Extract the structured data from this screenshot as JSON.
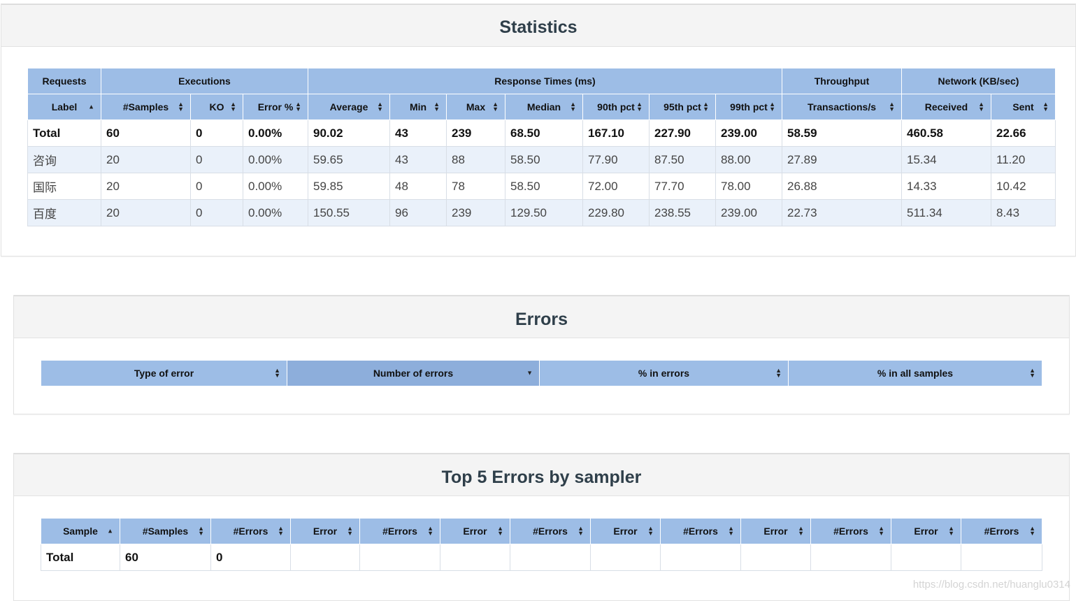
{
  "statistics": {
    "title": "Statistics",
    "groups": [
      "Requests",
      "Executions",
      "Response Times (ms)",
      "Throughput",
      "Network (KB/sec)"
    ],
    "columns": [
      "Label",
      "#Samples",
      "KO",
      "Error %",
      "Average",
      "Min",
      "Max",
      "Median",
      "90th pct",
      "95th pct",
      "99th pct",
      "Transactions/s",
      "Received",
      "Sent"
    ],
    "total": [
      "Total",
      "60",
      "0",
      "0.00%",
      "90.02",
      "43",
      "239",
      "68.50",
      "167.10",
      "227.90",
      "239.00",
      "58.59",
      "460.58",
      "22.66"
    ],
    "rows": [
      [
        "咨询",
        "20",
        "0",
        "0.00%",
        "59.65",
        "43",
        "88",
        "58.50",
        "77.90",
        "87.50",
        "88.00",
        "27.89",
        "15.34",
        "11.20"
      ],
      [
        "国际",
        "20",
        "0",
        "0.00%",
        "59.85",
        "48",
        "78",
        "58.50",
        "72.00",
        "77.70",
        "78.00",
        "26.88",
        "14.33",
        "10.42"
      ],
      [
        "百度",
        "20",
        "0",
        "0.00%",
        "150.55",
        "96",
        "239",
        "129.50",
        "229.80",
        "238.55",
        "239.00",
        "22.73",
        "511.34",
        "8.43"
      ]
    ]
  },
  "errors": {
    "title": "Errors",
    "columns": [
      "Type of error",
      "Number of errors",
      "% in errors",
      "% in all samples"
    ]
  },
  "top5": {
    "title": "Top 5 Errors by sampler",
    "columns": [
      "Sample",
      "#Samples",
      "#Errors",
      "Error",
      "#Errors",
      "Error",
      "#Errors",
      "Error",
      "#Errors",
      "Error",
      "#Errors",
      "Error",
      "#Errors"
    ],
    "total": [
      "Total",
      "60",
      "0",
      "",
      "",
      "",
      "",
      "",
      "",
      "",
      "",
      "",
      ""
    ]
  },
  "watermark": "https://blog.csdn.net/huanglu0314"
}
